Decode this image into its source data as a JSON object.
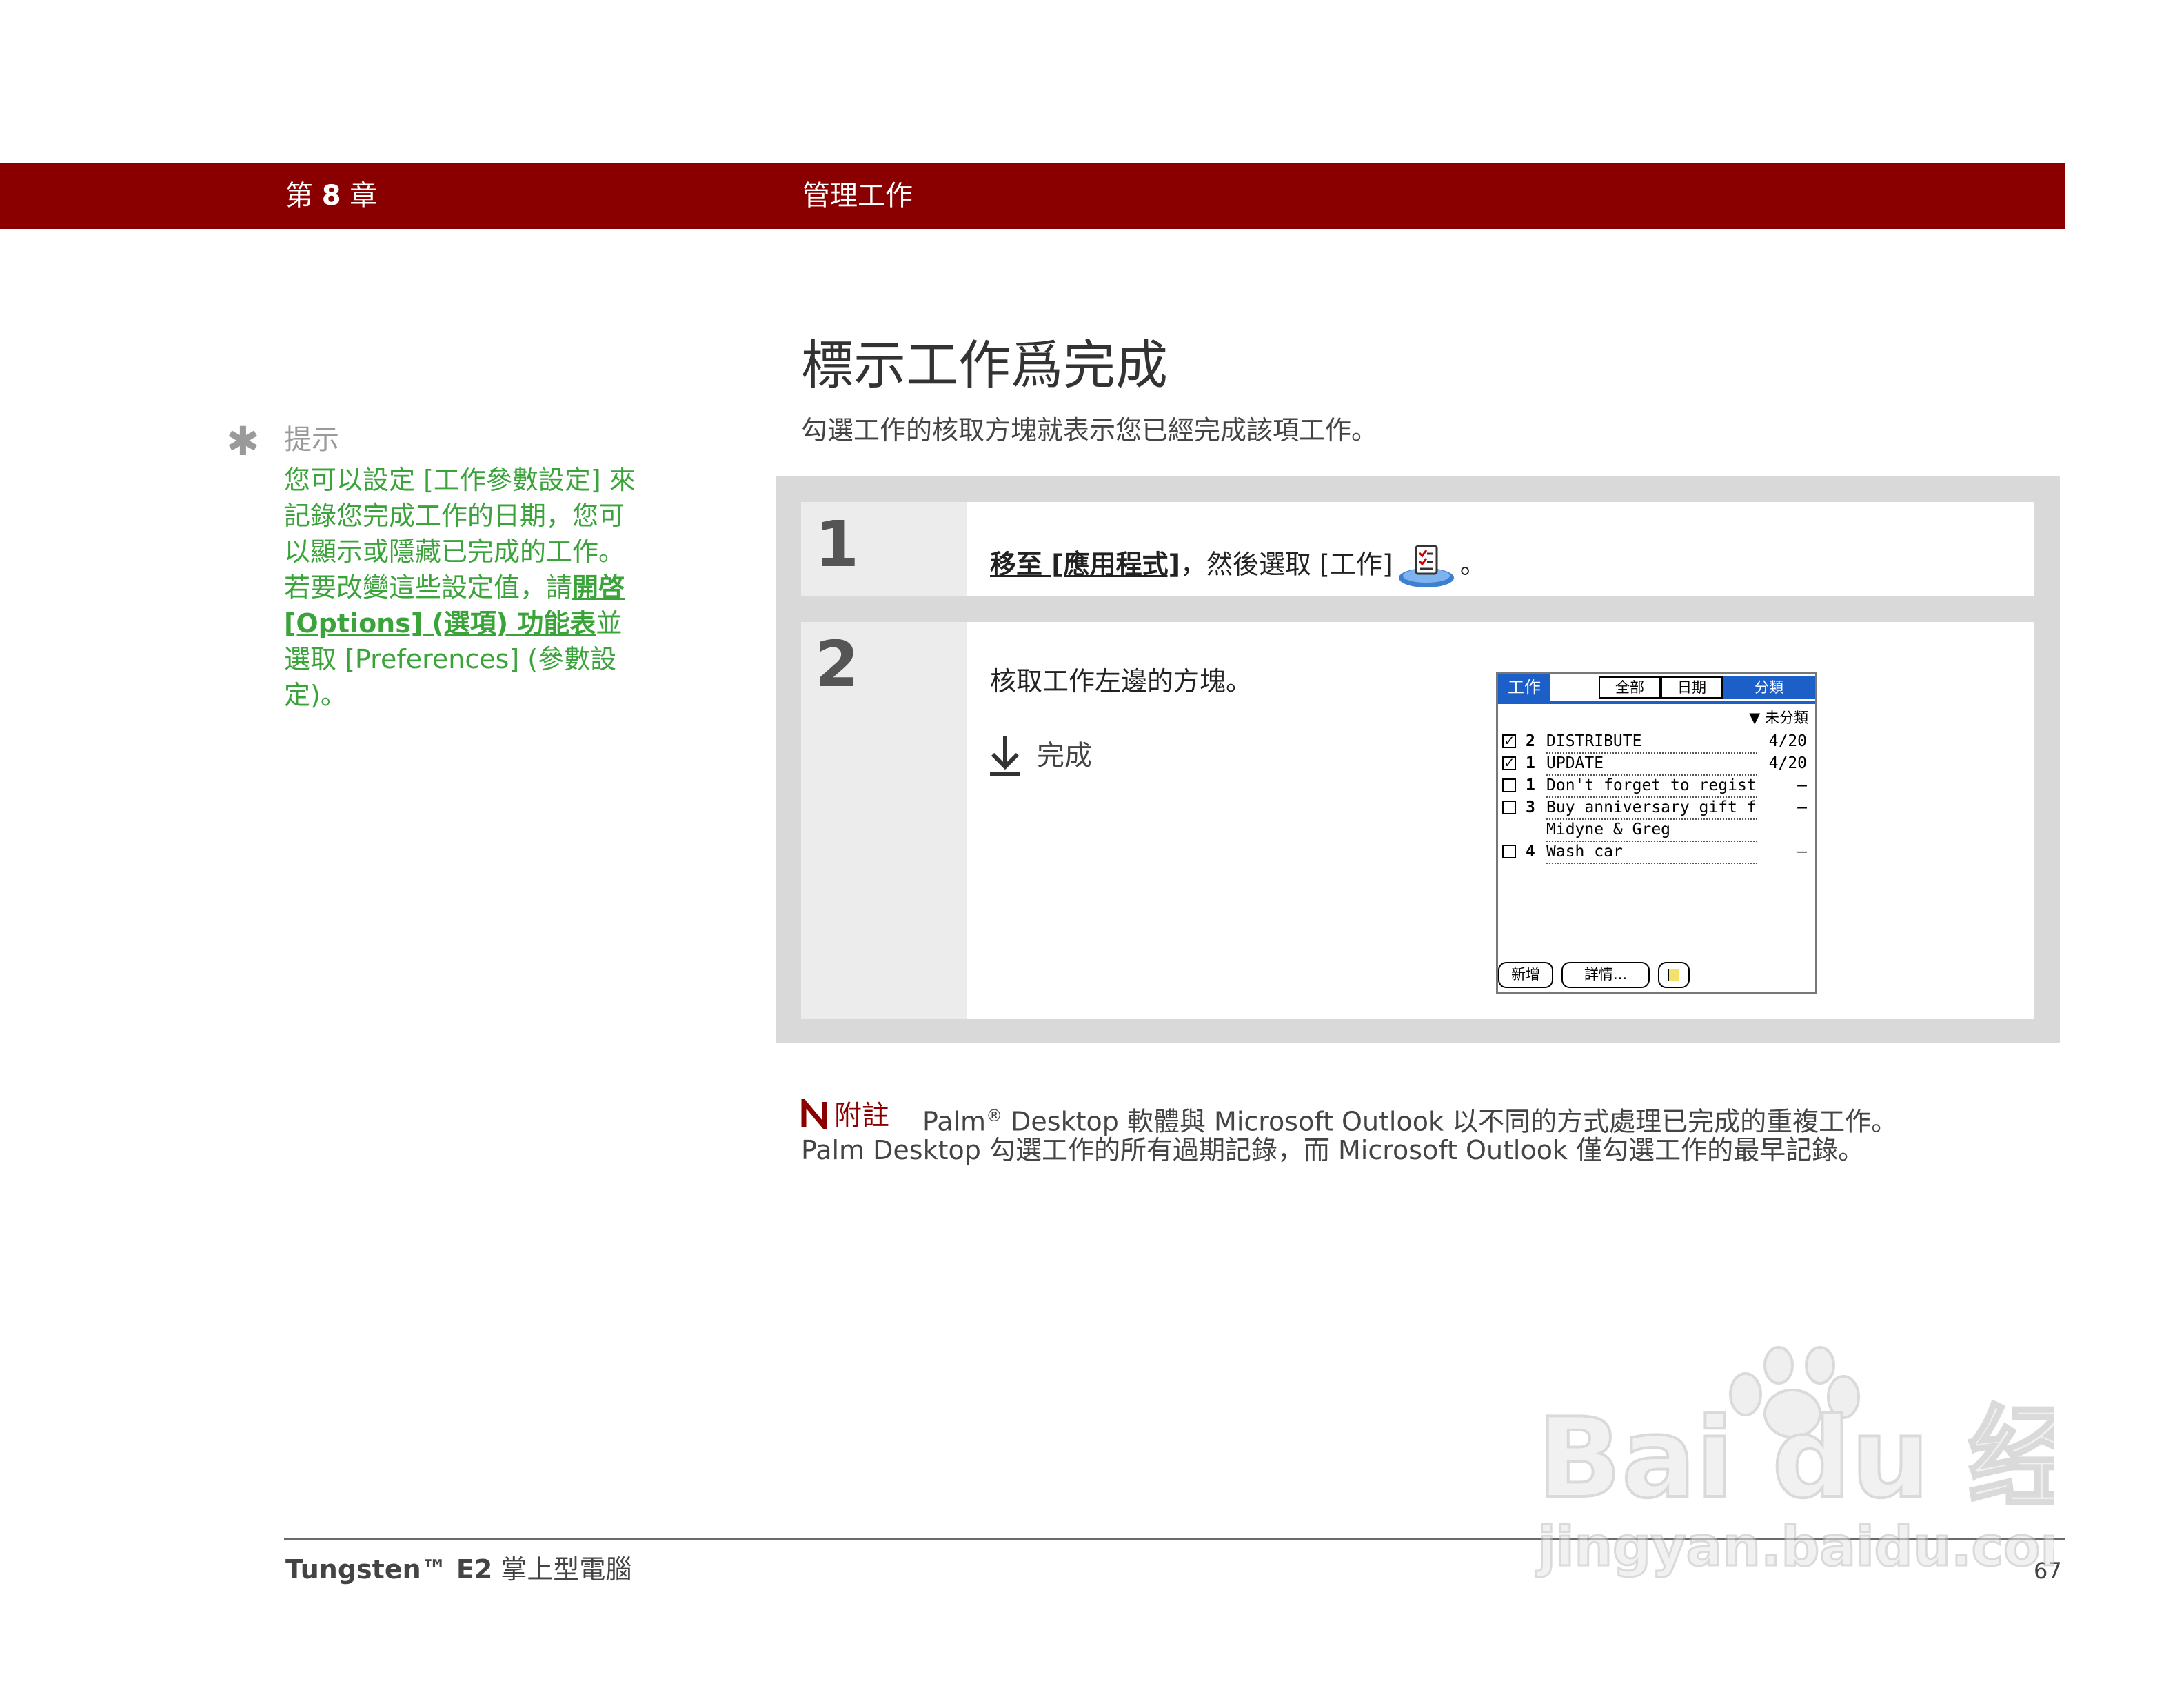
{
  "header": {
    "chapter_prefix": "第",
    "chapter_number": "8",
    "chapter_suffix": "章",
    "chapter_title": "管理工作",
    "bar_color": "#8a0000"
  },
  "tip": {
    "icon": "asterisk-icon",
    "heading": "提示",
    "body_before_link": "您可以設定 [工作參數設定] 來記錄您完成工作的日期，您可以顯示或隱藏已完成的工作。若要改變這些設定值，請",
    "link_text": "開啓 [Options] (選項) 功能表",
    "body_after_link": "並選取 [Preferences] (參數設定)。",
    "text_color": "#3aa33a"
  },
  "page": {
    "title": "標示工作爲完成",
    "intro": "勾選工作的核取方塊就表示您已經完成該項工作。"
  },
  "steps": [
    {
      "number": "1",
      "link_text": "移至 [應用程式]",
      "text_after": "，然後選取 [工作]",
      "app_icon": "tasks-app-icon",
      "end_punct": "。"
    },
    {
      "number": "2",
      "text": "核取工作左邊的方塊。",
      "done_icon": "down-arrow-done-icon",
      "done_label": "完成"
    }
  ],
  "palm_screen": {
    "app_title": "工作",
    "tabs": [
      "全部",
      "日期",
      "分類"
    ],
    "selected_tab": "分類",
    "category_dropdown": "未分類",
    "tasks": [
      {
        "checked": true,
        "priority": "2",
        "desc": "DISTRIBUTE",
        "due": "4/20",
        "note": false
      },
      {
        "checked": true,
        "priority": "1",
        "desc": "UPDATE",
        "due": "4/20",
        "note": false
      },
      {
        "checked": false,
        "priority": "1",
        "desc": "Don't forget to register!",
        "due": "–",
        "note": true
      },
      {
        "checked": false,
        "priority": "3",
        "desc": "Buy anniversary gift for",
        "desc2": "Midyne & Greg",
        "due": "–",
        "note": false
      },
      {
        "checked": false,
        "priority": "4",
        "desc": "Wash car",
        "due": "–",
        "note": false
      }
    ],
    "buttons": {
      "new": "新增",
      "details": "詳情..."
    },
    "accent_color": "#1c5fc8"
  },
  "note": {
    "icon": "note-icon",
    "label": "附註",
    "line1_pre": "Palm",
    "line1_reg": "®",
    "line1_post": " Desktop 軟體與 Microsoft Outlook 以不同的方式處理已完成的重複工作。",
    "line2": "Palm Desktop 勾選工作的所有過期記錄，而 Microsoft Outlook 僅勾選工作的最早記錄。"
  },
  "footer": {
    "product_bold": "Tungsten™ E2",
    "product_rest": " 掌上型電腦",
    "page_number": "67"
  },
  "watermark": {
    "brand": "Bai du 经验",
    "url": "jingyan.baidu.com"
  }
}
